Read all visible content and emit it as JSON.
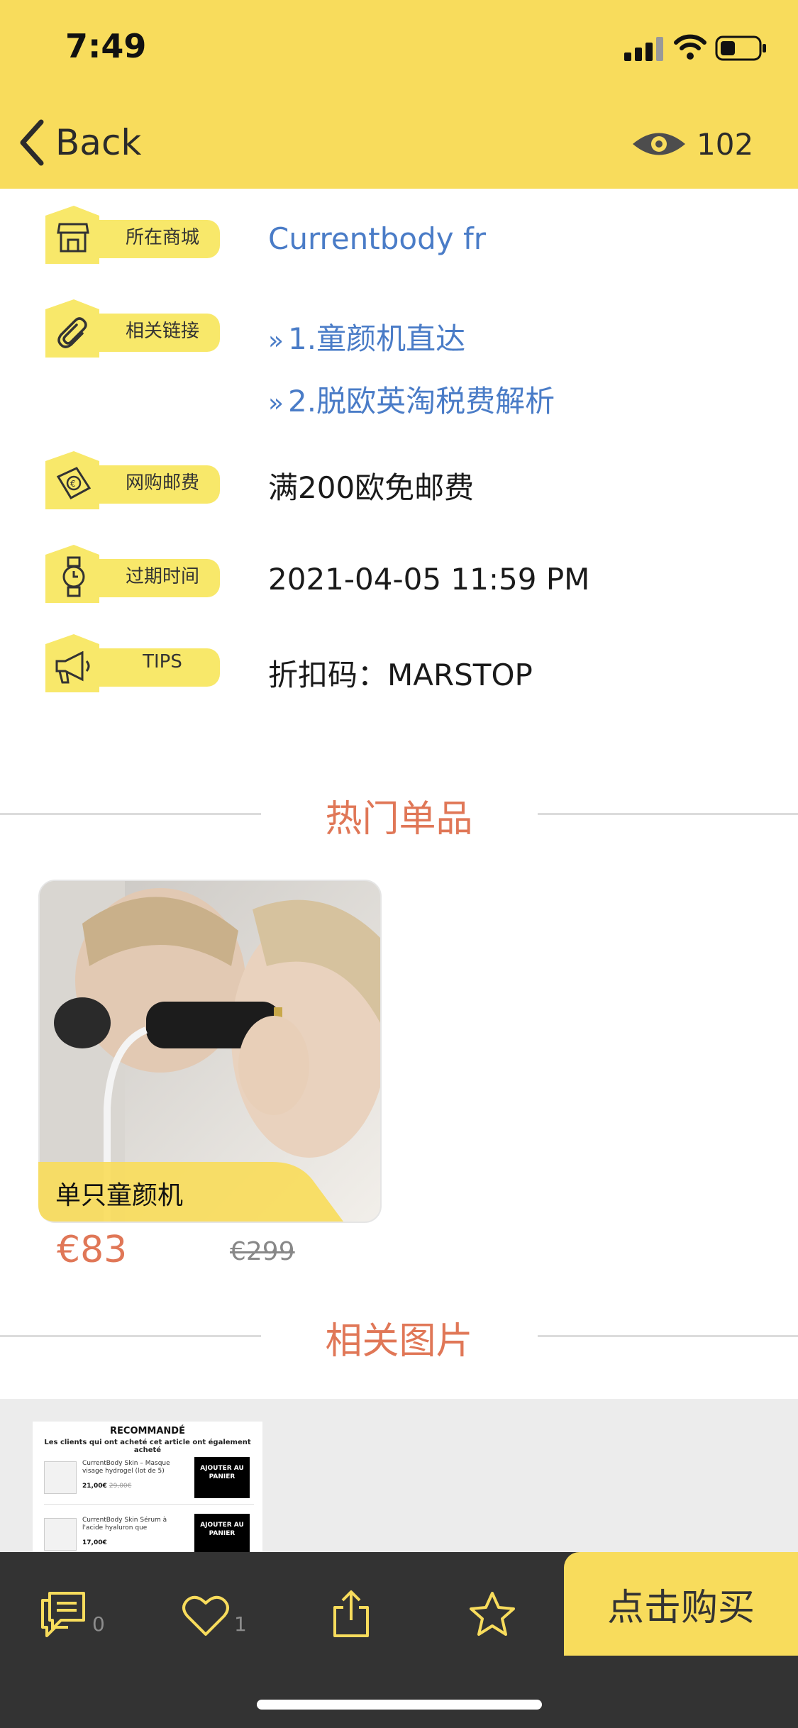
{
  "status_bar": {
    "time": "7:49"
  },
  "nav": {
    "back_label": "Back",
    "view_count": "102"
  },
  "info_rows": [
    {
      "label": "所在商城",
      "icon": "store-icon",
      "value": "Currentbody fr"
    },
    {
      "label": "相关链接",
      "icon": "paperclip-icon",
      "links": [
        "1.童颜机直达",
        "2.脱欧英淘税费解析"
      ]
    },
    {
      "label": "网购邮费",
      "icon": "euro-note-icon",
      "value": "满200欧免邮费"
    },
    {
      "label": "过期时间",
      "icon": "watch-icon",
      "value": "2021-04-05 11:59 PM"
    },
    {
      "label": "TIPS",
      "icon": "megaphone-icon",
      "value": "折扣码：MARSTOP"
    }
  ],
  "sections": {
    "hot_items": "热门单品",
    "related_images": "相关图片"
  },
  "product": {
    "name": "单只童颜机",
    "price": "€83",
    "original_price": "€299"
  },
  "gallery_thumb": {
    "title": "RECOMMANDÉ",
    "subtitle": "Les clients qui ont acheté cet article ont également acheté",
    "items": [
      {
        "name": "CurrentBody Skin – Masque visage hydrogel (lot de 5)",
        "price": "21,00€",
        "old_price": "29,00€",
        "button": "AJOUTER AU PANIER"
      },
      {
        "name": "CurrentBody Skin Sérum à l'acide hyaluron que",
        "price": "17,00€",
        "button": "AJOUTER AU PANIER"
      }
    ]
  },
  "tabbar": {
    "comments_count": "0",
    "likes_count": "1",
    "buy_label": "点击购买"
  },
  "colors": {
    "accent_yellow": "#f8dc5c",
    "link_blue": "#4a7cc7",
    "section_orange": "#e07757",
    "tabbar_bg": "#333333"
  }
}
